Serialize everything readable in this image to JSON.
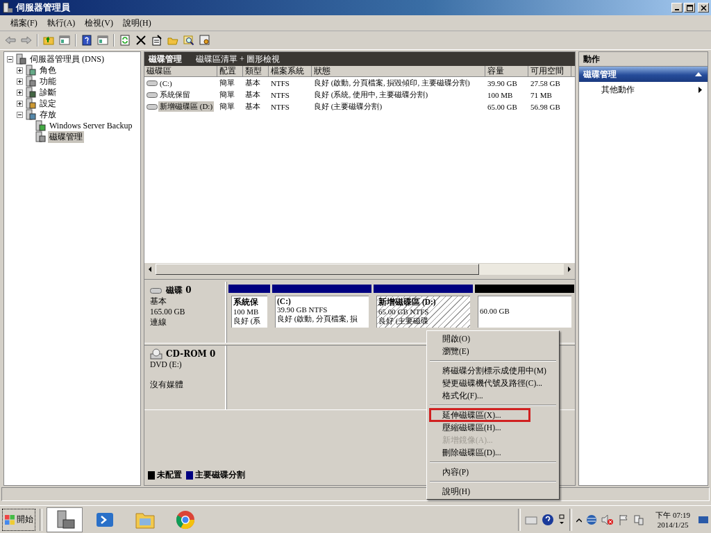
{
  "window": {
    "title": "伺服器管理員"
  },
  "menu_bar": [
    "檔案(F)",
    "執行(A)",
    "檢視(V)",
    "說明(H)"
  ],
  "tree": {
    "label": "伺服器管理員 (DNS)",
    "kind": "server",
    "expanded": true,
    "selected": false,
    "children": [
      {
        "label": "角色",
        "kind": "roles",
        "expanded": false,
        "selected": false
      },
      {
        "label": "功能",
        "kind": "features",
        "expanded": false,
        "selected": false
      },
      {
        "label": "診斷",
        "kind": "diagnostics",
        "expanded": false,
        "selected": false
      },
      {
        "label": "設定",
        "kind": "config",
        "expanded": false,
        "selected": false
      },
      {
        "label": "存放",
        "kind": "storage",
        "expanded": true,
        "selected": false,
        "children": [
          {
            "label": "Windows Server Backup",
            "kind": "backup",
            "selected": false
          },
          {
            "label": "磁碟管理",
            "kind": "disk",
            "selected": true
          }
        ]
      }
    ]
  },
  "center": {
    "title": "磁碟管理",
    "subtitle": "磁碟區清單 + 圖形檢視"
  },
  "table": {
    "columns": [
      "磁碟區",
      "配置",
      "類型",
      "檔案系統",
      "狀態",
      "容量",
      "可用空間"
    ],
    "rows": [
      {
        "cells": [
          "(C:)",
          "簡單",
          "基本",
          "NTFS",
          "良好 (啟動, 分頁檔案, 損毀傾印, 主要磁碟分割)",
          "39.90 GB",
          "27.58 GB"
        ],
        "selected": false
      },
      {
        "cells": [
          "系統保留",
          "簡單",
          "基本",
          "NTFS",
          "良好 (系統, 使用中, 主要磁碟分割)",
          "100 MB",
          "71 MB"
        ],
        "selected": false
      },
      {
        "cells": [
          "新增磁碟區 (D:)",
          "簡單",
          "基本",
          "NTFS",
          "良好 (主要磁碟分割)",
          "65.00 GB",
          "56.98 GB"
        ],
        "selected": true
      }
    ]
  },
  "disks": [
    {
      "name": "磁碟 0",
      "kind": "disk",
      "lines": [
        "基本",
        "165.00 GB"
      ],
      "status": "連線",
      "partitions": [
        {
          "kind": "primary",
          "name": "系統保",
          "lines": [
            "100 MB",
            "良好 (系"
          ],
          "selected": false
        },
        {
          "kind": "primary",
          "name": "(C:)",
          "lines": [
            "39.90 GB NTFS",
            "良好 (啟動, 分頁檔案, 損"
          ],
          "selected": false
        },
        {
          "kind": "primary",
          "name": "新增磁碟區  (D:)",
          "lines": [
            "65.00 GB NTFS",
            "良好 (主要磁碟"
          ],
          "selected": true
        },
        {
          "kind": "unallocated",
          "lines": [
            "60.00 GB"
          ],
          "selected": false
        }
      ]
    },
    {
      "name": "CD-ROM 0",
      "kind": "cdrom",
      "lines": [
        "DVD (E:)"
      ],
      "status": "沒有媒體"
    }
  ],
  "legend": [
    {
      "label": "未配置",
      "color": "#000000"
    },
    {
      "label": "主要磁碟分割",
      "color": "#000080"
    }
  ],
  "context_menu": [
    {
      "kind": "item",
      "label": "開啟(O)",
      "disabled": false,
      "marked": false
    },
    {
      "kind": "item",
      "label": "瀏覽(E)",
      "disabled": false,
      "marked": false
    },
    {
      "kind": "separator"
    },
    {
      "kind": "item",
      "label": "將磁碟分割標示成使用中(M)",
      "disabled": false,
      "marked": false
    },
    {
      "kind": "item",
      "label": "變更磁碟機代號及路徑(C)...",
      "disabled": false,
      "marked": false
    },
    {
      "kind": "item",
      "label": "格式化(F)...",
      "disabled": false,
      "marked": false
    },
    {
      "kind": "separator"
    },
    {
      "kind": "item",
      "label": "延伸磁碟區(X)...",
      "disabled": false,
      "marked": true
    },
    {
      "kind": "item",
      "label": "壓縮磁碟區(H)...",
      "disabled": false,
      "marked": false
    },
    {
      "kind": "item",
      "label": "新增鏡像(A)...",
      "disabled": true,
      "marked": false
    },
    {
      "kind": "item",
      "label": "刪除磁碟區(D)...",
      "disabled": false,
      "marked": false
    },
    {
      "kind": "separator"
    },
    {
      "kind": "item",
      "label": "內容(P)",
      "disabled": false,
      "marked": false
    },
    {
      "kind": "separator"
    },
    {
      "kind": "item",
      "label": "說明(H)",
      "disabled": false,
      "marked": false
    }
  ],
  "actions": {
    "title": "動作",
    "section": {
      "label": "磁碟管理",
      "expanded": true
    },
    "items": [
      {
        "label": "其他動作"
      }
    ]
  },
  "taskbar": {
    "start": "開始",
    "time": "下午 07:19",
    "date": "2014/1/25"
  }
}
